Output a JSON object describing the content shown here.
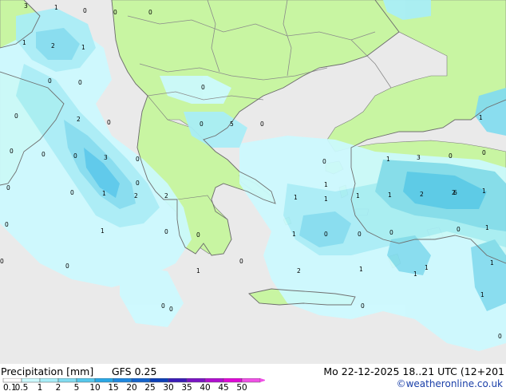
{
  "title": "Precipitation [mm]",
  "model": "GFS 0.25",
  "timestamp": "Mo 22-12-2025 18..21 UTC (12+201",
  "credit": "©weatheronline.co.uk",
  "colors": {
    "sea": "#eaeaea",
    "land": "#c8f5a2",
    "border": "#8a8a8a",
    "coast": "#7a7a7a"
  },
  "legend": {
    "labels": [
      "0.1",
      "0.5",
      "1",
      "2",
      "5",
      "10",
      "15",
      "20",
      "25",
      "30",
      "35",
      "40",
      "45",
      "50"
    ],
    "colors": [
      "#ffffff",
      "#ccfaff",
      "#a8eef8",
      "#82dcf0",
      "#56c8ec",
      "#2aa8e6",
      "#1e88e0",
      "#1464cc",
      "#0c3fb8",
      "#3a1cb8",
      "#7a14c4",
      "#b00ed0",
      "#e008d8",
      "#f050e6"
    ]
  },
  "map_labels": [
    "3",
    "1",
    "0",
    "0",
    "0",
    "2",
    "1",
    "1",
    "0",
    "0",
    "0",
    "0",
    "0",
    "0",
    "2",
    "0",
    "0",
    "0",
    "0",
    "5",
    "0",
    "0",
    "0",
    "3",
    "1",
    "0",
    "1",
    "0",
    "1",
    "3",
    "0",
    "0",
    "0",
    "0",
    "1",
    "2",
    "2",
    "1",
    "1",
    "1",
    "1",
    "2",
    "2",
    "1",
    "1",
    "0",
    "1",
    "0",
    "0",
    "1",
    "0",
    "1",
    "1",
    "1",
    "2",
    "1",
    "0",
    "1",
    "6",
    "0",
    "0",
    "0",
    "1",
    "0",
    "0",
    "0",
    "0"
  ]
}
